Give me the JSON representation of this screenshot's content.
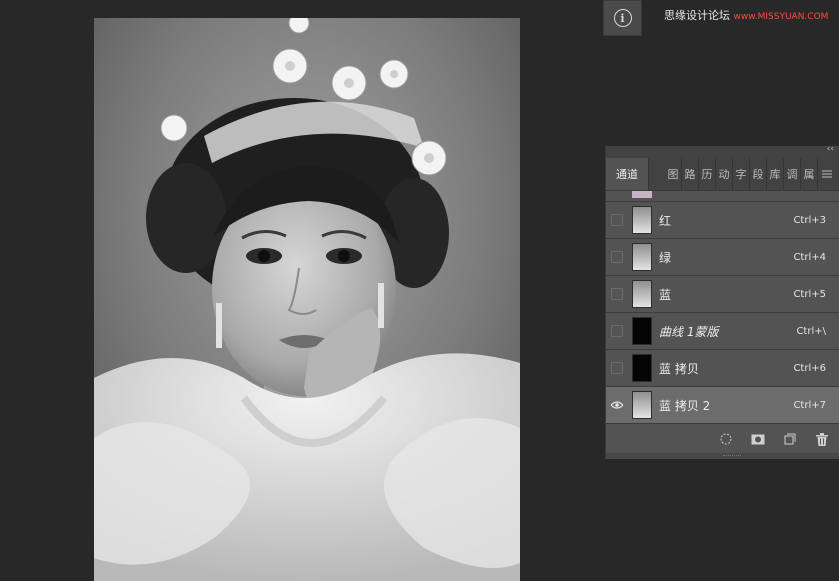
{
  "canvas": {
    "icon": "portrait-photo"
  },
  "info": {
    "icon": "info-icon",
    "glyph": "i"
  },
  "watermark": {
    "text": "思缘设计论坛",
    "url": "www.MISSYUAN.COM"
  },
  "panel": {
    "collapse_icon": "‹‹",
    "tabs": [
      {
        "label": "通道",
        "active": true
      },
      {
        "label": "图"
      },
      {
        "label": "路"
      },
      {
        "label": "历"
      },
      {
        "label": "动"
      },
      {
        "label": "字"
      },
      {
        "label": "段"
      },
      {
        "label": "库"
      },
      {
        "label": "调"
      },
      {
        "label": "属"
      }
    ],
    "menu_icon": "panel-menu-icon",
    "channels": [
      {
        "name": "红",
        "shortcut": "Ctrl+3",
        "visible": false,
        "thumb": "light"
      },
      {
        "name": "绿",
        "shortcut": "Ctrl+4",
        "visible": false,
        "thumb": "light"
      },
      {
        "name": "蓝",
        "shortcut": "Ctrl+5",
        "visible": false,
        "thumb": "light"
      },
      {
        "name": "曲线 1蒙版",
        "shortcut": "Ctrl+\\",
        "visible": false,
        "thumb": "dark",
        "italic": true
      },
      {
        "name": "蓝 拷贝",
        "shortcut": "Ctrl+6",
        "visible": false,
        "thumb": "dark"
      },
      {
        "name": "蓝 拷贝 2",
        "shortcut": "Ctrl+7",
        "visible": true,
        "thumb": "light",
        "selected": true
      }
    ],
    "footer_icons": [
      "load-selection-icon",
      "save-selection-icon",
      "new-channel-icon",
      "delete-icon"
    ]
  }
}
